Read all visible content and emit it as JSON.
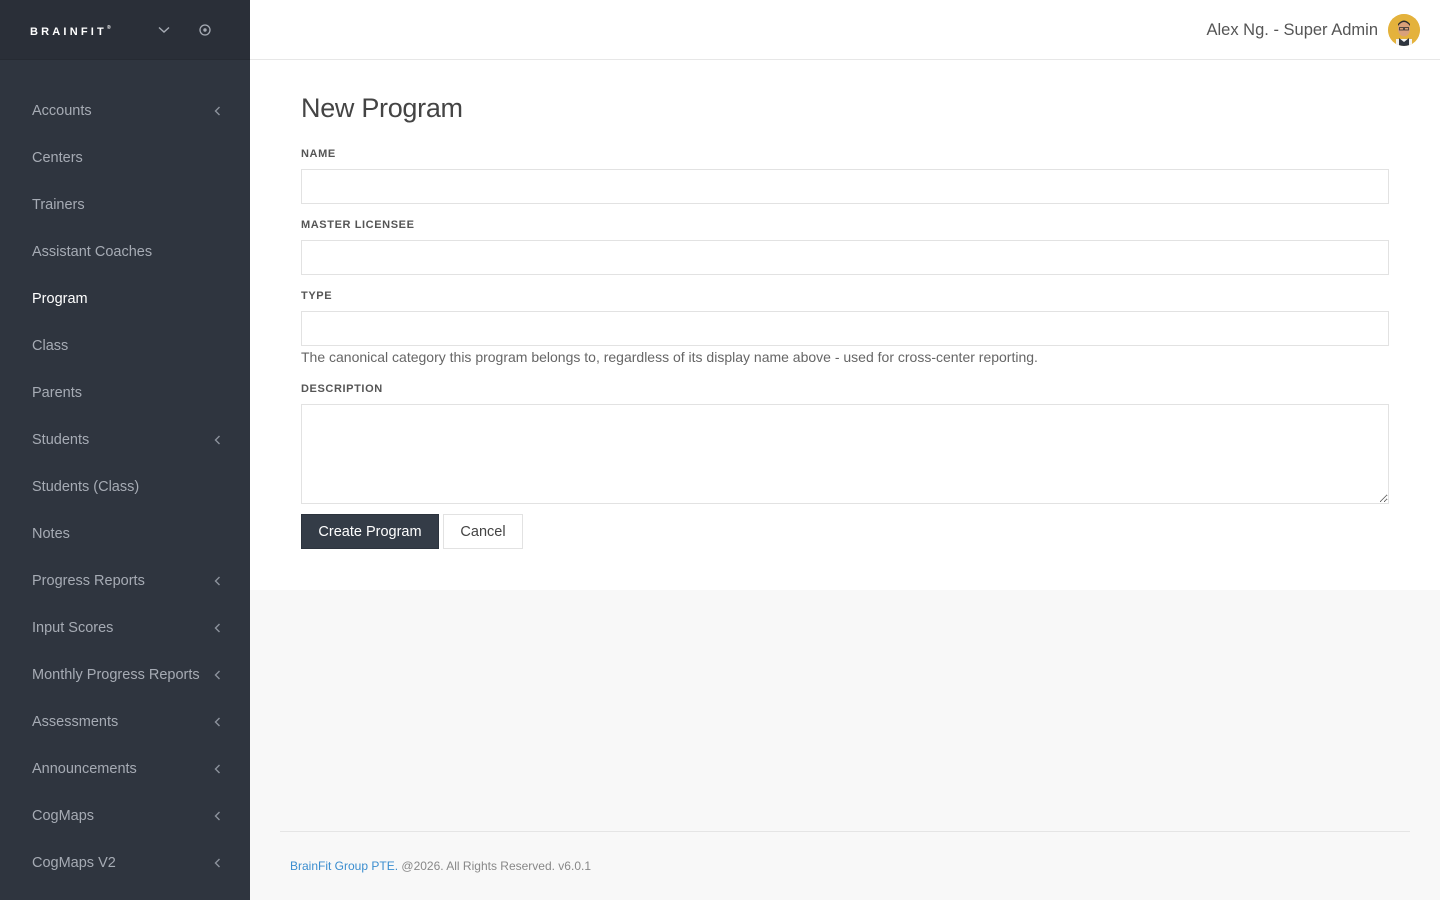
{
  "brand": {
    "logo_text": "BRAINFIT",
    "logo_mark": "®"
  },
  "sidebar": {
    "items": [
      {
        "label": "Accounts",
        "has_submenu": true
      },
      {
        "label": "Centers",
        "has_submenu": false
      },
      {
        "label": "Trainers",
        "has_submenu": false
      },
      {
        "label": "Assistant Coaches",
        "has_submenu": false
      },
      {
        "label": "Program",
        "has_submenu": false,
        "active": true
      },
      {
        "label": "Class",
        "has_submenu": false
      },
      {
        "label": "Parents",
        "has_submenu": false
      },
      {
        "label": "Students",
        "has_submenu": true
      },
      {
        "label": "Students (Class)",
        "has_submenu": false
      },
      {
        "label": "Notes",
        "has_submenu": false
      },
      {
        "label": "Progress Reports",
        "has_submenu": true
      },
      {
        "label": "Input Scores",
        "has_submenu": true
      },
      {
        "label": "Monthly Progress Reports",
        "has_submenu": true
      },
      {
        "label": "Assessments",
        "has_submenu": true
      },
      {
        "label": "Announcements",
        "has_submenu": true
      },
      {
        "label": "CogMaps",
        "has_submenu": true
      },
      {
        "label": "CogMaps V2",
        "has_submenu": true
      }
    ]
  },
  "header": {
    "user": "Alex Ng. - Super Admin"
  },
  "form": {
    "title": "New Program",
    "name_label": "NAME",
    "name_value": "",
    "master_licensee_label": "MASTER LICENSEE",
    "master_licensee_value": "",
    "type_label": "TYPE",
    "type_value": "",
    "type_help": "The canonical category this program belongs to, regardless of its display name above - used for cross-center reporting.",
    "description_label": "DESCRIPTION",
    "description_value": "",
    "submit_label": "Create Program",
    "cancel_label": "Cancel"
  },
  "footer": {
    "company": "BrainFit Group PTE.",
    "text": " @2026. All Rights Reserved. v6.0.1"
  },
  "colors": {
    "sidebar_bg": "#2f353f",
    "primary_button": "#343c47",
    "link": "#3a8dcf",
    "content_bg": "#f8f8f8"
  }
}
